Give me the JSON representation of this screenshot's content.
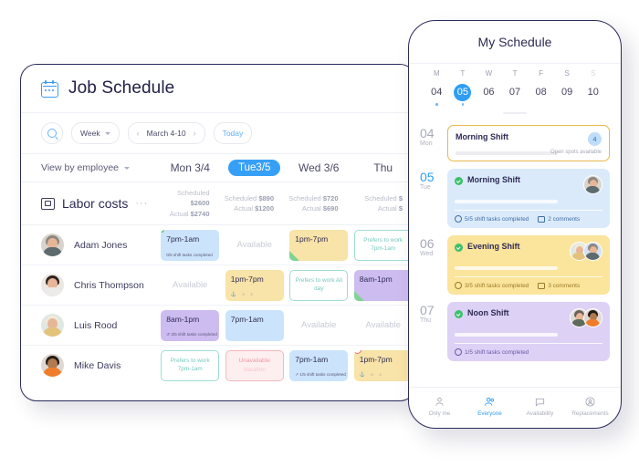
{
  "desktop": {
    "title": "Job Schedule",
    "title_icon": "calendar-icon",
    "toolbar": {
      "search_icon": "search-icon",
      "view_mode": "Week",
      "prev": "‹",
      "date_range": "March 4-10",
      "next": "›",
      "today": "Today"
    },
    "view_by": "View by employee",
    "day_columns": [
      {
        "label": "Mon 3/4",
        "selected": false
      },
      {
        "label": "Tue3/5",
        "selected": true
      },
      {
        "label": "Wed 3/6",
        "selected": false
      },
      {
        "label": "Thu",
        "selected": false
      }
    ],
    "labor": {
      "icon": "money-icon",
      "label": "Labor costs",
      "menu": "···",
      "columns": [
        {
          "scheduled_label": "Scheduled",
          "scheduled": "$2600",
          "actual_label": "Actual",
          "actual": "$2740"
        },
        {
          "scheduled_label": "Scheduled",
          "scheduled": "$890",
          "actual_label": "Actual",
          "actual": "$1200"
        },
        {
          "scheduled_label": "Scheduled",
          "scheduled": "$720",
          "actual_label": "Actual",
          "actual": "$690"
        },
        {
          "scheduled_label": "Scheduled",
          "scheduled": "$",
          "actual_label": "Actual",
          "actual": "$"
        }
      ]
    },
    "employees": [
      {
        "name": "Adam Jones",
        "cells": [
          {
            "kind": "shift",
            "color": "blue",
            "time": "7pm-1am",
            "sub": "0/5 shift tasks completed",
            "dot": true
          },
          {
            "kind": "available",
            "text": "Available"
          },
          {
            "kind": "shift",
            "color": "yellow",
            "time": "1pm-7pm",
            "corner": true
          },
          {
            "kind": "prefers",
            "text": "Prefers to work 7pm-1am"
          }
        ]
      },
      {
        "name": "Chris Thompson",
        "cells": [
          {
            "kind": "available",
            "text": "Available"
          },
          {
            "kind": "shift",
            "color": "yellow",
            "time": "1pm-7pm",
            "mini": "⚓ ☼ ♪"
          },
          {
            "kind": "prefers",
            "text": "Prefers to work All day"
          },
          {
            "kind": "shift",
            "color": "purple",
            "time": "8am-1pm",
            "corner": true
          }
        ]
      },
      {
        "name": "Luis Rood",
        "cells": [
          {
            "kind": "shift",
            "color": "purple",
            "time": "8am-1pm",
            "sub": "↺ 3/5 shift tasks completed"
          },
          {
            "kind": "shift",
            "color": "blue",
            "time": "7pm-1am"
          },
          {
            "kind": "available",
            "text": "Available"
          },
          {
            "kind": "available",
            "text": "Available"
          }
        ]
      },
      {
        "name": "Mike Davis",
        "cells": [
          {
            "kind": "prefers",
            "text": "Prefers to work 7pm-1am"
          },
          {
            "kind": "unavailable",
            "text": "Unavailable",
            "note": "Vacation"
          },
          {
            "kind": "shift",
            "color": "blue",
            "time": "7pm-1am",
            "sub": "↗ 1/5 shift tasks completed"
          },
          {
            "kind": "shift",
            "color": "yellow",
            "time": "1pm-7pm",
            "mini": "⚓ ☼ ♪",
            "alert": "!"
          }
        ]
      }
    ]
  },
  "phone": {
    "title": "My Schedule",
    "week": [
      {
        "dow": "M",
        "num": "04",
        "active": false,
        "dot": true,
        "dim": false
      },
      {
        "dow": "T",
        "num": "05",
        "active": true,
        "dot": true,
        "dim": false
      },
      {
        "dow": "W",
        "num": "06",
        "active": false,
        "dot": false,
        "dim": false
      },
      {
        "dow": "T",
        "num": "07",
        "active": false,
        "dot": false,
        "dim": false
      },
      {
        "dow": "F",
        "num": "08",
        "active": false,
        "dot": false,
        "dim": false
      },
      {
        "dow": "S",
        "num": "09",
        "active": false,
        "dot": false,
        "dim": false
      },
      {
        "dow": "S",
        "num": "10",
        "active": false,
        "dot": false,
        "dim": true
      }
    ],
    "days": [
      {
        "num": "04",
        "dow": "Mon",
        "highlight": false,
        "style": "open",
        "shift": "Morning Shift",
        "check": false,
        "badge": "4",
        "badge_text": "Open spots available",
        "tasks": null,
        "comments": null,
        "avatars": []
      },
      {
        "num": "05",
        "dow": "Tue",
        "highlight": true,
        "style": "c-blue",
        "shift": "Morning Shift",
        "check": true,
        "badge": null,
        "badge_text": null,
        "tasks": "5/5 shift tasks completed",
        "comments": "2 comments",
        "avatars": [
          "adam"
        ]
      },
      {
        "num": "06",
        "dow": "Wed",
        "highlight": false,
        "style": "c-yellow",
        "shift": "Evening Shift",
        "check": true,
        "badge": null,
        "badge_text": null,
        "tasks": "3/5 shift tasks completed",
        "comments": "3 comments",
        "avatars": [
          "luis",
          "adam"
        ]
      },
      {
        "num": "07",
        "dow": "Thu",
        "highlight": false,
        "style": "c-purple",
        "shift": "Noon Shift",
        "check": true,
        "badge": null,
        "badge_text": null,
        "tasks": "1/5 shift tasks completed",
        "comments": null,
        "avatars": [
          "chris2",
          "mike"
        ]
      }
    ],
    "nav": [
      {
        "label": "Only me",
        "icon": "person-icon",
        "active": false
      },
      {
        "label": "Everyone",
        "icon": "people-icon",
        "active": true
      },
      {
        "label": "Availability",
        "icon": "chat-icon",
        "active": false
      },
      {
        "label": "Replacements",
        "icon": "person-circle-icon",
        "active": false
      }
    ]
  },
  "colors": {
    "accent": "#2e9df5",
    "ink": "#2b2b5c",
    "shift_blue": "#cbe4fb",
    "shift_yellow": "#f8e3a8",
    "shift_purple": "#cdbcf0",
    "prefers_border": "#9fdcd4",
    "unavailable": "#f4b8bd",
    "green": "#3cc06a"
  }
}
